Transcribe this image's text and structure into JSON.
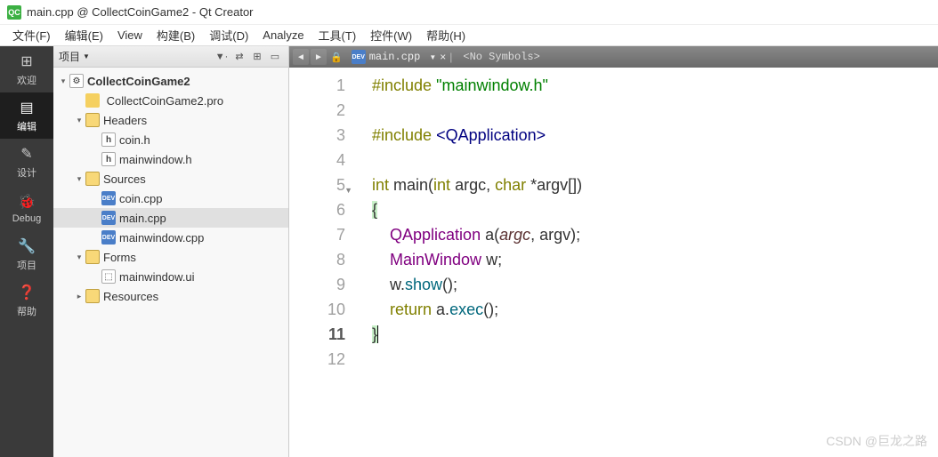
{
  "title": "main.cpp @ CollectCoinGame2 - Qt Creator",
  "menu": [
    "文件(F)",
    "编辑(E)",
    "View",
    "构建(B)",
    "调试(D)",
    "Analyze",
    "工具(T)",
    "控件(W)",
    "帮助(H)"
  ],
  "leftbar": [
    {
      "label": "欢迎",
      "icon": "⊞"
    },
    {
      "label": "编辑",
      "icon": "▤",
      "active": true
    },
    {
      "label": "设计",
      "icon": "✎"
    },
    {
      "label": "Debug",
      "icon": "🐞"
    },
    {
      "label": "项目",
      "icon": "🔧"
    },
    {
      "label": "帮助",
      "icon": "❓"
    }
  ],
  "sidepanel": {
    "title": "项目"
  },
  "tree": {
    "project": "CollectCoinGame2",
    "pro": "CollectCoinGame2.pro",
    "headers": {
      "label": "Headers",
      "items": [
        "coin.h",
        "mainwindow.h"
      ]
    },
    "sources": {
      "label": "Sources",
      "items": [
        "coin.cpp",
        "main.cpp",
        "mainwindow.cpp"
      ],
      "selected": "main.cpp"
    },
    "forms": {
      "label": "Forms",
      "items": [
        "mainwindow.ui"
      ]
    },
    "resources": {
      "label": "Resources"
    }
  },
  "editor": {
    "tab": "main.cpp",
    "symbols": "<No Symbols>",
    "close": "×",
    "current_line": 11
  },
  "code": [
    {
      "n": 1,
      "t": [
        [
          "kw",
          "#include"
        ],
        [
          "",
          " "
        ],
        [
          "str",
          "\"mainwindow.h\""
        ]
      ]
    },
    {
      "n": 2,
      "t": []
    },
    {
      "n": 3,
      "t": [
        [
          "kw",
          "#include"
        ],
        [
          "",
          " "
        ],
        [
          "inc",
          "<QApplication>"
        ]
      ]
    },
    {
      "n": 4,
      "t": []
    },
    {
      "n": 5,
      "fold": true,
      "t": [
        [
          "kw",
          "int"
        ],
        [
          "",
          " "
        ],
        [
          "",
          "main"
        ],
        [
          "",
          "("
        ],
        [
          "kw",
          "int"
        ],
        [
          "",
          " argc, "
        ],
        [
          "kw",
          "char"
        ],
        [
          "",
          " *argv[])"
        ]
      ]
    },
    {
      "n": 6,
      "t": [
        [
          "brace-hl",
          "{"
        ]
      ]
    },
    {
      "n": 7,
      "t": [
        [
          "",
          "    "
        ],
        [
          "type",
          "QApplication"
        ],
        [
          "",
          " a("
        ],
        [
          "arg",
          "argc"
        ],
        [
          "",
          ", argv);"
        ]
      ]
    },
    {
      "n": 8,
      "t": [
        [
          "",
          "    "
        ],
        [
          "type",
          "MainWindow"
        ],
        [
          "",
          " w;"
        ]
      ]
    },
    {
      "n": 9,
      "t": [
        [
          "",
          "    w."
        ],
        [
          "func",
          "show"
        ],
        [
          "",
          "();"
        ]
      ]
    },
    {
      "n": 10,
      "t": [
        [
          "",
          "    "
        ],
        [
          "kw",
          "return"
        ],
        [
          "",
          " a."
        ],
        [
          "func",
          "exec"
        ],
        [
          "",
          "();"
        ]
      ]
    },
    {
      "n": 11,
      "t": [
        [
          "brace-hl",
          "}"
        ],
        [
          "cursor",
          ""
        ]
      ]
    },
    {
      "n": 12,
      "t": []
    }
  ],
  "watermark": "CSDN @巨龙之路"
}
